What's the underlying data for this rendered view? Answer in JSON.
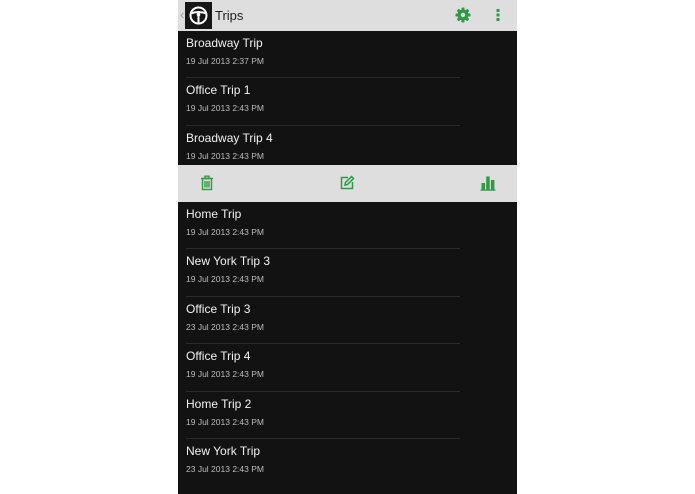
{
  "action_bar": {
    "title": "Trips",
    "back_glyph": "‹",
    "logo_icon": "steering-wheel-icon",
    "settings_icon": "gear-icon",
    "overflow_icon": "overflow-menu-icon"
  },
  "colors": {
    "accent": "#2e9a44",
    "bar_background": "#dedede",
    "list_background": "#121212"
  },
  "trips_top": [
    {
      "title": "Broadway Trip",
      "date": "19 Jul 2013 2:37 PM"
    },
    {
      "title": "Office Trip 1",
      "date": "19 Jul 2013 2:43 PM"
    },
    {
      "title": "Broadway Trip 4",
      "date": "19 Jul 2013 2:43 PM"
    }
  ],
  "contextual_bar": {
    "delete_icon": "trash-icon",
    "edit_icon": "edit-icon",
    "stats_icon": "bar-chart-icon"
  },
  "trips_bottom": [
    {
      "title": "Home Trip",
      "date": "19 Jul 2013 2:43 PM"
    },
    {
      "title": "New York Trip 3",
      "date": "19 Jul 2013 2:43 PM"
    },
    {
      "title": "Office Trip 3",
      "date": "23 Jul 2013 2:43 PM"
    },
    {
      "title": "Office Trip 4",
      "date": "19 Jul 2013 2:43 PM"
    },
    {
      "title": "Home Trip 2",
      "date": "19 Jul 2013 2:43 PM"
    },
    {
      "title": "New York Trip",
      "date": "23 Jul 2013 2:43 PM"
    }
  ]
}
